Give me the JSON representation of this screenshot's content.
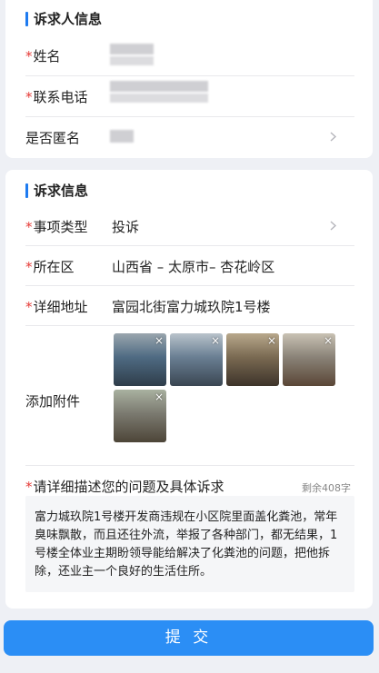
{
  "petitioner": {
    "section_title": "诉求人信息",
    "name_label": "姓名",
    "phone_label": "联系电话",
    "anonymous_label": "是否匿名"
  },
  "appeal": {
    "section_title": "诉求信息",
    "type_label": "事项类型",
    "type_value": "投诉",
    "area_label": "所在区",
    "area_value": "山西省 – 太原市– 杏花岭区",
    "address_label": "详细地址",
    "address_value": "富园北街富力城玖院1号楼",
    "attachment_label": "添加附件",
    "attachments": [
      {
        "icon": "photo-thumbnail",
        "colors": [
          "#4f6b83",
          "#9aa6ae",
          "#2f3d4a"
        ]
      },
      {
        "icon": "photo-thumbnail",
        "colors": [
          "#6a7f93",
          "#b9c3cb",
          "#3a4652"
        ]
      },
      {
        "icon": "photo-thumbnail",
        "colors": [
          "#7a6a52",
          "#b8a88c",
          "#3d332a"
        ]
      },
      {
        "icon": "photo-thumbnail",
        "colors": [
          "#8a8378",
          "#c9c2b4",
          "#5a4636"
        ]
      },
      {
        "icon": "photo-thumbnail",
        "colors": [
          "#7b7a70",
          "#a9b1a0",
          "#4d4538"
        ]
      }
    ],
    "desc_label": "请详细描述您的问题及具体诉求",
    "remaining": "剩余408字",
    "desc_text": "富力城玖院1号楼开发商违规在小区院里面盖化粪池，常年臭味飘散，而且还往外流，举报了各种部门，都无结果，1号楼全体业主期盼领导能给解决了化粪池的问题，把他拆除，还业主一个良好的生活住所。"
  },
  "submit_label": "提 交",
  "colors": {
    "accent": "#1e7bf0",
    "required": "#e53935",
    "submit_bg": "#2b8ef5",
    "page_bg": "#eef0f5"
  }
}
